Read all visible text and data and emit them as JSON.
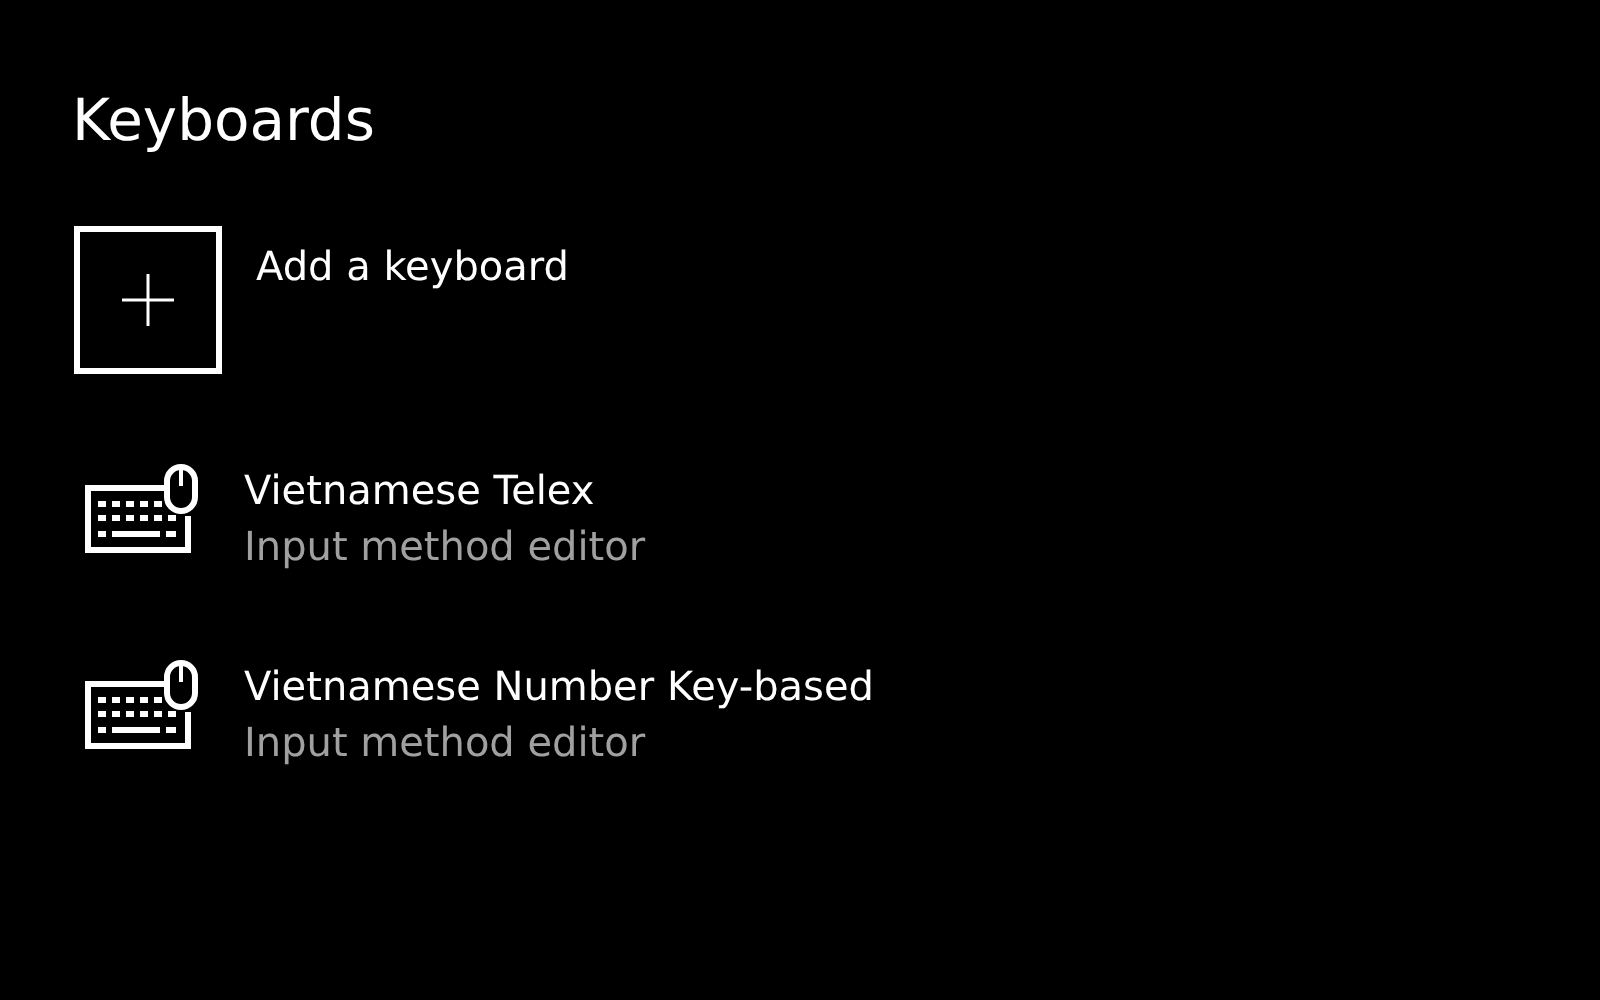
{
  "title": "Keyboards",
  "add_button": {
    "label": "Add a keyboard"
  },
  "keyboards": [
    {
      "name": "Vietnamese Telex",
      "description": "Input method editor"
    },
    {
      "name": "Vietnamese Number Key-based",
      "description": "Input method editor"
    }
  ]
}
